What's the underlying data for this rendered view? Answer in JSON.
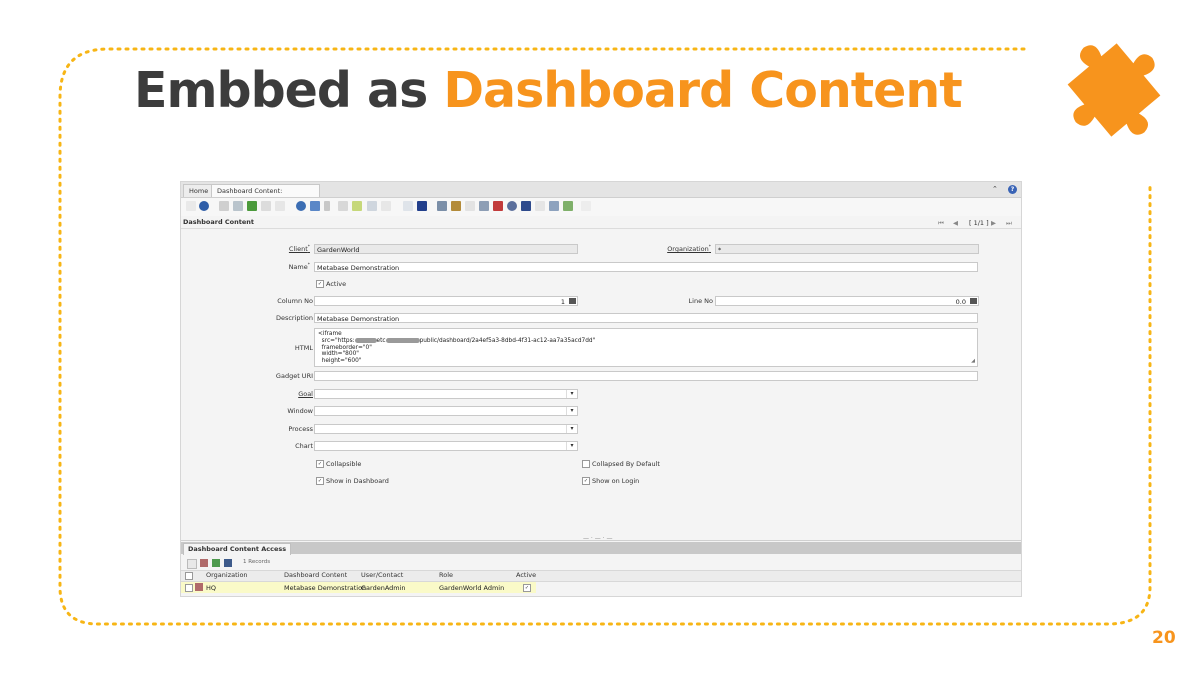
{
  "slide": {
    "title_part1": "Embbed as",
    "title_part2": "Dashboard Content",
    "page_number": "20",
    "accent_color": "#f7941d",
    "title_color": "#3c3c3c"
  },
  "app": {
    "tabs": [
      {
        "label": "Home"
      },
      {
        "label": "Dashboard Content: Metabase..."
      }
    ],
    "window_title": "Dashboard Content",
    "record_position": "[ 1/1 ]",
    "form": {
      "client_label": "Client",
      "client_value": "GardenWorld",
      "organization_label": "Organization",
      "organization_value": "*",
      "name_label": "Name",
      "name_value": "Metabase Demonstration",
      "active_label": "Active",
      "column_no_label": "Column No",
      "column_no_value": "1",
      "line_no_label": "Line No",
      "line_no_value": "0.0",
      "description_label": "Description",
      "description_value": "Metabase Demonstration",
      "html_label": "HTML",
      "html_lines": {
        "l1": "<iframe",
        "l2a": "  src=\"https:",
        "l2b": "etc",
        "l2c": "public/dashboard/2a4ef5a3-8dbd-4f31-ac12-aa7a35acd7dd\"",
        "l3": "  frameborder=\"0\"",
        "l4": "  width=\"800\"",
        "l5": "  height=\"600\""
      },
      "gadget_uri_label": "Gadget URI",
      "goal_label": "Goal",
      "window_label": "Window",
      "process_label": "Process",
      "chart_label": "Chart",
      "collapsible_label": "Collapsible",
      "collapsed_by_default_label": "Collapsed By Default",
      "show_in_dashboard_label": "Show in Dashboard",
      "show_on_login_label": "Show on Login"
    },
    "detail": {
      "tab_label": "Dashboard Content Access",
      "records": "1 Records",
      "columns": [
        "Organization",
        "Dashboard Content",
        "User/Contact",
        "Role",
        "Active"
      ],
      "rows": [
        {
          "organization": "HQ",
          "dashboard_content": "Metabase Demonstration",
          "user_contact": "GardenAdmin",
          "role": "GardenWorld Admin"
        }
      ]
    }
  }
}
